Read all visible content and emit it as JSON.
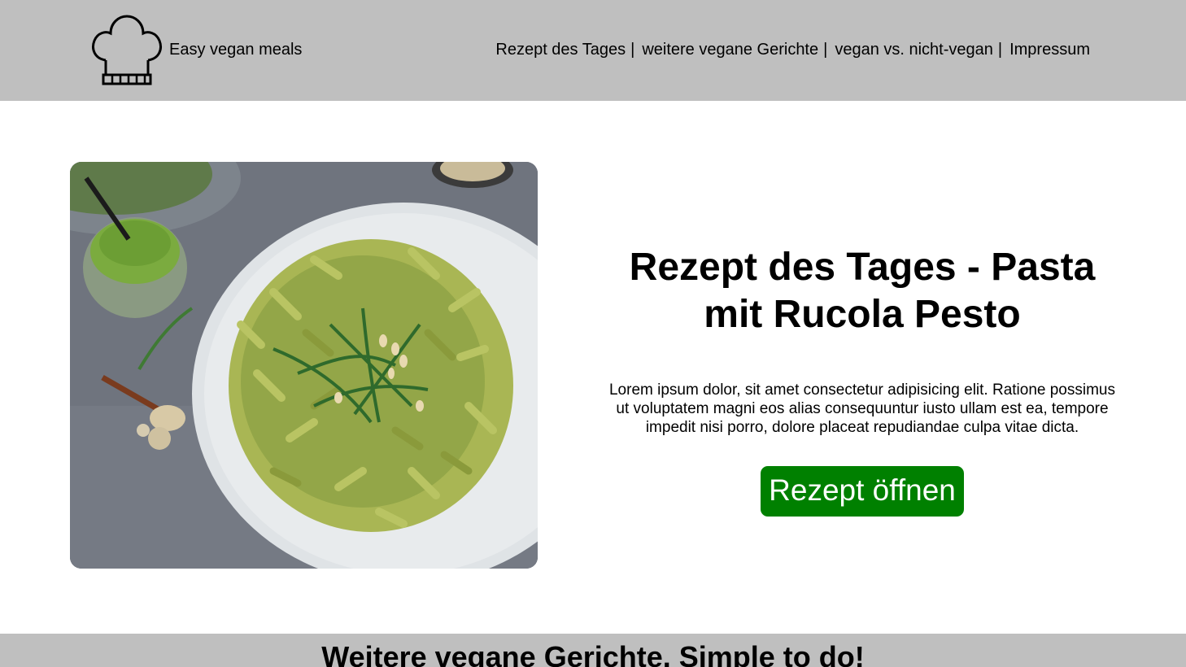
{
  "header": {
    "brand": "Easy vegan meals",
    "logo_icon": "chef-hat-icon",
    "nav": [
      {
        "label": "Rezept des Tages",
        "sep": "|"
      },
      {
        "label": "weitere vegane Gerichte",
        "sep": "|"
      },
      {
        "label": "vegan vs. nicht-vegan",
        "sep": "|"
      },
      {
        "label": "Impressum",
        "sep": ""
      }
    ]
  },
  "hero": {
    "image_alt": "Pasta mit Rucola Pesto",
    "title": "Rezept des Tages - Pasta mit Rucola Pesto",
    "description": "Lorem ipsum dolor, sit amet consectetur adipisicing elit. Ratione possimus ut voluptatem magni eos alias consequuntur iusto ullam est ea, tempore impedit nisi porro, dolore placeat repudiandae culpa vitae dicta.",
    "button_label": "Rezept öffnen"
  },
  "more": {
    "heading": "Weitere vegane Gerichte. Simple to do!"
  },
  "colors": {
    "header_bg": "#bfbfbf",
    "button_bg": "#008000",
    "button_text": "#ffffff"
  }
}
